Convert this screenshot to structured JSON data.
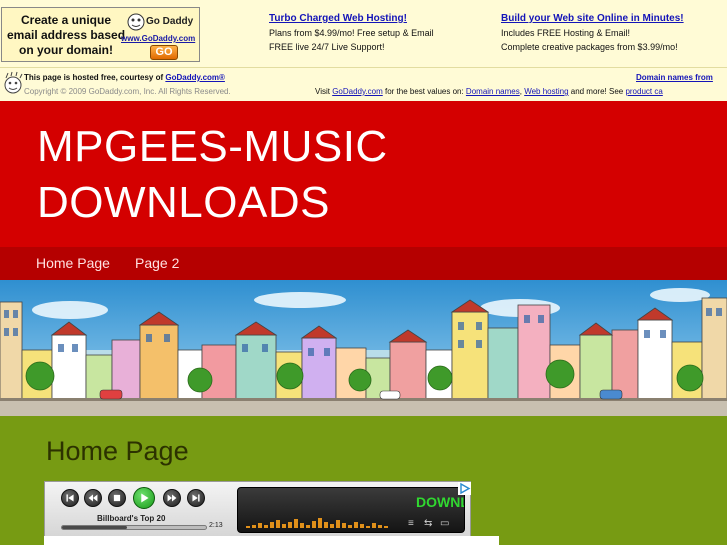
{
  "ad_box": {
    "line1": "Create a unique",
    "line2": "email address based",
    "line3": "on your domain!",
    "logo_text": "Go Daddy",
    "url": "www.GoDaddy.com",
    "go_label": "GO"
  },
  "ad_col1": {
    "title": "Turbo Charged Web Hosting!",
    "line1": "Plans from $4.99/mo! Free setup & Email",
    "line2": "FREE live 24/7 Live Support!"
  },
  "ad_col2": {
    "title": "Build your Web site Online in Minutes!",
    "line1": "Includes FREE Hosting & Email!",
    "line2": "Complete creative packages from $3.99/mo!"
  },
  "hosted": {
    "prefix": "This page is hosted free, courtesy of ",
    "link": "GoDaddy.com®",
    "copyright": "Copyright © 2009 GoDaddy.com, Inc. All Rights Reserved.",
    "right_link": "Domain names from",
    "visit_prefix": "Visit ",
    "visit_link": "GoDaddy.com",
    "visit_mid": " for the best values on: ",
    "visit_link2": "Domain names",
    "visit_sep": ", ",
    "visit_link3": "Web hosting",
    "visit_mid2": " and more! See ",
    "visit_link4": "product ca"
  },
  "site": {
    "title_line1": "MPGEES-MUSIC",
    "title_line2": "DOWNLOADS"
  },
  "nav": {
    "items": [
      "Home Page",
      "Page 2"
    ]
  },
  "main": {
    "heading": "Home Page"
  },
  "player": {
    "track": "Billboard's Top 20",
    "time": "2:13",
    "progress": 0.45,
    "display_text": "DOWNL",
    "ad_badge": "▷"
  },
  "colors": {
    "header_red": "#d40000",
    "nav_red": "#b50000",
    "content_green": "#779b13",
    "ad_yellow": "#fffbd6",
    "link_blue": "#1414b8"
  }
}
